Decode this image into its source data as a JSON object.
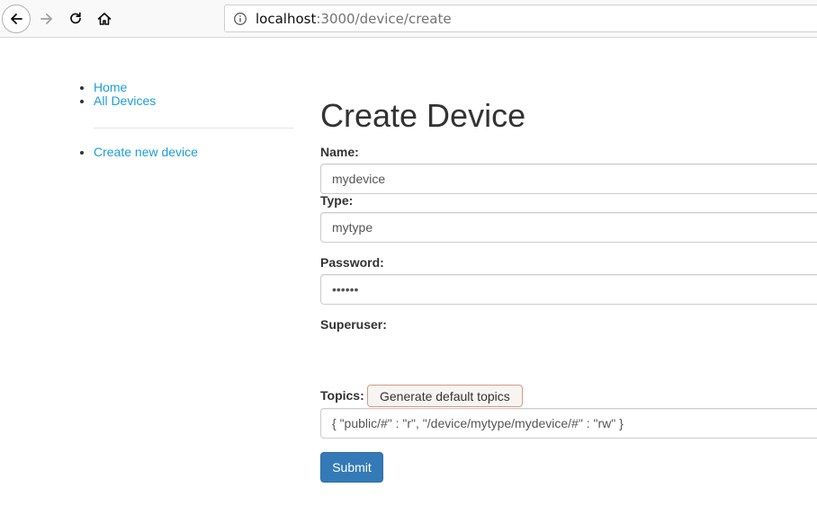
{
  "browser": {
    "url_host": "localhost",
    "url_path": ":3000/device/create"
  },
  "sidebar": {
    "nav_items": [
      {
        "label": "Home"
      },
      {
        "label": "All Devices"
      }
    ],
    "action_items": [
      {
        "label": "Create new device"
      }
    ]
  },
  "form": {
    "title": "Create Device",
    "name": {
      "label": "Name:",
      "value": "mydevice"
    },
    "type": {
      "label": "Type:",
      "value": "mytype"
    },
    "password": {
      "label": "Password:",
      "value": "••••••"
    },
    "superuser": {
      "label": "Superuser:"
    },
    "topics": {
      "label": "Topics:",
      "generate_label": "Generate default topics",
      "value": "{ \"public/#\" : \"r\", \"/device/mytype/mydevice/#\" : \"rw\" }"
    },
    "submit_label": "Submit"
  },
  "icons": {
    "back": "back-arrow-icon",
    "forward": "forward-arrow-icon",
    "reload": "reload-icon",
    "home": "home-icon",
    "info": "info-icon"
  },
  "colors": {
    "link": "#1a9fd6",
    "primary_button": "#337ab7",
    "text": "#333333"
  }
}
